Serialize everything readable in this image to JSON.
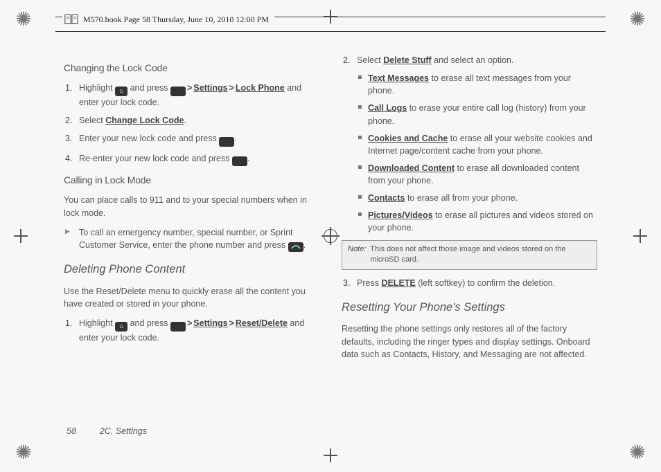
{
  "bookplate": "M570.book  Page 58  Thursday, June 10, 2010  12:00 PM",
  "left": {
    "h3a": "Changing the Lock Code",
    "s1a_pre": "Highlight ",
    "s1a_mid": " and press ",
    "s1a_nav1": "Settings",
    "s1a_nav2": "Lock Phone",
    "s1a_post": " and enter your lock code.",
    "s2a": "Select ",
    "s2a_ui": "Change Lock Code",
    "s2a_post": ".",
    "s3a": "Enter your new lock code and press ",
    "s3a_post": ".",
    "s4a": "Re-enter your new lock code and press ",
    "s4a_post": ".",
    "h3b": "Calling in Lock Mode",
    "pb": "You can place calls to 911 and to your special numbers when in lock mode.",
    "trib": "To call an emergency number, special number, or Sprint Customer Service, enter the phone number and press ",
    "trib_post": ".",
    "h2c": "Deleting Phone Content",
    "pc": "Use the Reset/Delete menu to quickly erase all the content you have created or stored in your phone.",
    "s1c_pre": "Highlight ",
    "s1c_mid": " and press ",
    "s1c_nav1": "Settings",
    "s1c_nav2": "Reset/Delete",
    "s1c_post": " and enter your lock code."
  },
  "right": {
    "s2": "Select ",
    "s2_ui": "Delete Stuff",
    "s2_post": " and select an option.",
    "b_tm": "Text Messages",
    "b_tm_post": " to erase all text messages from your phone.",
    "b_cl": "Call Logs",
    "b_cl_post": " to erase your entire call log (history) from your phone.",
    "b_cc": "Cookies and Cache",
    "b_cc_post": " to erase all your website cookies and Internet page/content cache from your phone.",
    "b_dc": "Downloaded Content",
    "b_dc_post": " to erase all downloaded content from your phone.",
    "b_ct": "Contacts",
    "b_ct_post": " to erase all from your phone.",
    "b_pv": "Pictures/Videos",
    "b_pv_post": " to erase all pictures and videos stored on your phone.",
    "note_label": "Note:",
    "note_body": "This does not affect those image and videos stored on the microSD card.",
    "s3": "Press ",
    "s3_ui": "DELETE",
    "s3_post": " (left softkey) to confirm the deletion.",
    "h2": "Resetting Your Phone's Settings",
    "p2": "Resetting the phone settings only restores all of the factory defaults, including the ringer types and display settings. Onboard data such as Contacts, History, and Messaging are not affected."
  },
  "footer": {
    "pageNum": "58",
    "section": "2C. Settings"
  }
}
